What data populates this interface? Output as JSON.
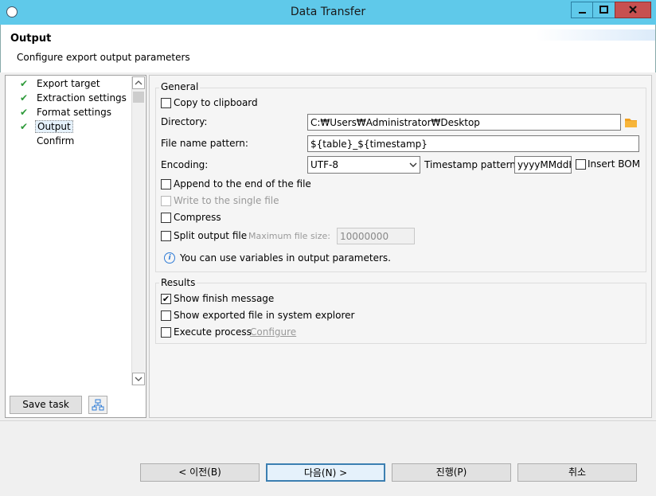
{
  "window": {
    "title": "Data Transfer",
    "controls": [
      "minimize",
      "maximize",
      "close"
    ]
  },
  "header": {
    "title": "Output",
    "subtitle": "Configure export output parameters"
  },
  "nav": {
    "items": [
      {
        "label": "Export target",
        "done": true
      },
      {
        "label": "Extraction settings",
        "done": true
      },
      {
        "label": "Format settings",
        "done": true
      },
      {
        "label": "Output",
        "done": true,
        "selected": true
      },
      {
        "label": "Confirm",
        "done": false
      }
    ],
    "save_task_label": "Save task"
  },
  "general": {
    "label": "General",
    "copy_to_clipboard": "Copy to clipboard",
    "directory_label": "Directory:",
    "directory_value": "C:₩Users₩Administrator₩Desktop",
    "file_name_pattern_label": "File name pattern:",
    "file_name_pattern_value": "${table}_${timestamp}",
    "encoding_label": "Encoding:",
    "encoding_value": "UTF-8",
    "timestamp_pattern_label": "Timestamp pattern:",
    "timestamp_pattern_value": "yyyyMMddHHmm",
    "insert_bom": "Insert BOM",
    "append_to_end": "Append to the end of the file",
    "write_single_file": "Write to the single file",
    "compress": "Compress",
    "split_output_file": "Split output file",
    "max_file_size_label": "Maximum file size:",
    "max_file_size_value": "10000000",
    "info_text": "You can use variables in output parameters."
  },
  "results": {
    "label": "Results",
    "show_finish_message": "Show finish message",
    "show_finish_message_checked": true,
    "show_exported_file": "Show exported file in system explorer",
    "execute_process": "Execute process",
    "configure_link": "Configure"
  },
  "footer": {
    "back_label": "< 이전(B)",
    "next_label": "다음(N) >",
    "proceed_label": "진행(P)",
    "cancel_label": "취소"
  },
  "colors": {
    "titlebar": "#5fc9ea",
    "check": "#2e9a3a",
    "folder_icon": "#f0a020",
    "info_icon": "#2e7bd6"
  }
}
